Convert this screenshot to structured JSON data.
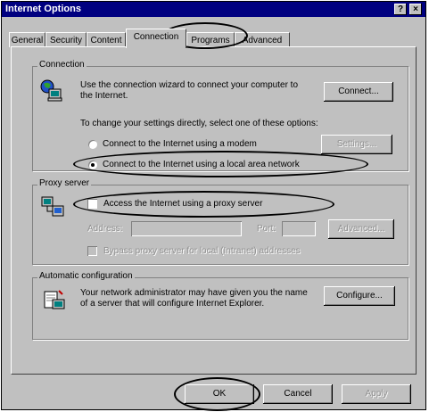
{
  "window": {
    "title": "Internet Options",
    "help_btn": "?",
    "close_btn": "×"
  },
  "tabs": [
    {
      "label": "General"
    },
    {
      "label": "Security"
    },
    {
      "label": "Content"
    },
    {
      "label": "Connection"
    },
    {
      "label": "Programs"
    },
    {
      "label": "Advanced"
    }
  ],
  "connection": {
    "legend": "Connection",
    "wizard_text": "Use the connection wizard to connect your computer to the Internet.",
    "connect_btn": "Connect...",
    "change_text": "To change your settings directly, select one of these options:",
    "radio_modem": "Connect to the Internet using a modem",
    "settings_btn": "Settings...",
    "radio_lan": "Connect to the Internet using a local area network"
  },
  "proxy": {
    "legend": "Proxy server",
    "checkbox_label": "Access the Internet using a proxy server",
    "address_label": "Address:",
    "port_label": "Port:",
    "advanced_btn": "Advanced...",
    "bypass_label": "Bypass proxy server for local (Intranet) addresses"
  },
  "auto": {
    "legend": "Automatic configuration",
    "text": "Your network administrator may have given you the name of a server that will configure Internet Explorer.",
    "configure_btn": "Configure..."
  },
  "footer": {
    "ok": "OK",
    "cancel": "Cancel",
    "apply": "Apply"
  }
}
